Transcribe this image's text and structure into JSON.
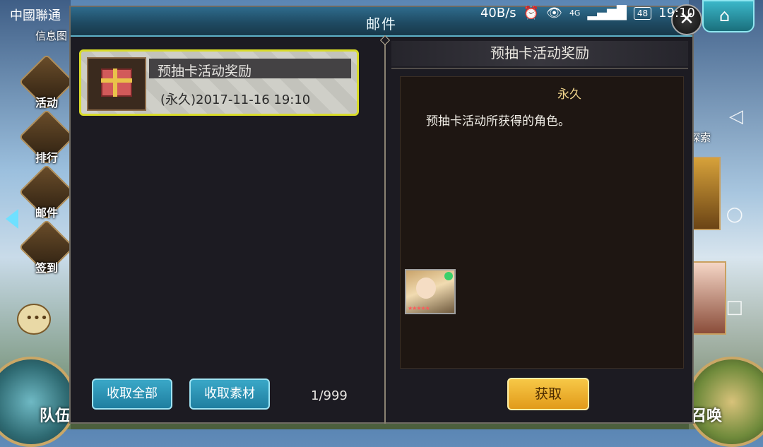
{
  "status_bar": {
    "carrier": "中國聯通",
    "speed": "40B/s",
    "network": "4G",
    "battery": "48",
    "time": "19:10"
  },
  "side_menu": {
    "info_label": "信息图",
    "items": [
      {
        "label": "活动",
        "icon": "event-egg-icon"
      },
      {
        "label": "排行",
        "icon": "ranking-scroll-icon"
      },
      {
        "label": "邮件",
        "icon": "mail-envelope-icon"
      },
      {
        "label": "签到",
        "icon": "calendar-checkin-icon"
      }
    ],
    "chat_icon": "chat-bubble-icon",
    "team_label": "队伍"
  },
  "right_menu": {
    "home_icon": "home-icon",
    "badge_label": "探索",
    "summon_label": "召唤"
  },
  "dialog": {
    "title": "邮件",
    "close_icon": "close-icon",
    "mail_list": [
      {
        "title": "预抽卡活动奖励",
        "date": "(永久)2017-11-16  19:10",
        "icon": "gift-box-icon",
        "selected": true
      }
    ],
    "buttons": {
      "collect_all": "收取全部",
      "collect_materials": "收取素材"
    },
    "pager": "1/999",
    "detail": {
      "heading": "预抽卡活动奖励",
      "expiry": "永久",
      "description": "预抽卡活动所获得的角色。",
      "reward_icon": "character-portrait-icon",
      "claim_button": "获取"
    }
  },
  "colors": {
    "header_teal": "#2e6b8c",
    "selected_border": "#d9dc2a",
    "claim_gold": "#f7c847",
    "teal_button": "#3aa8c8"
  }
}
